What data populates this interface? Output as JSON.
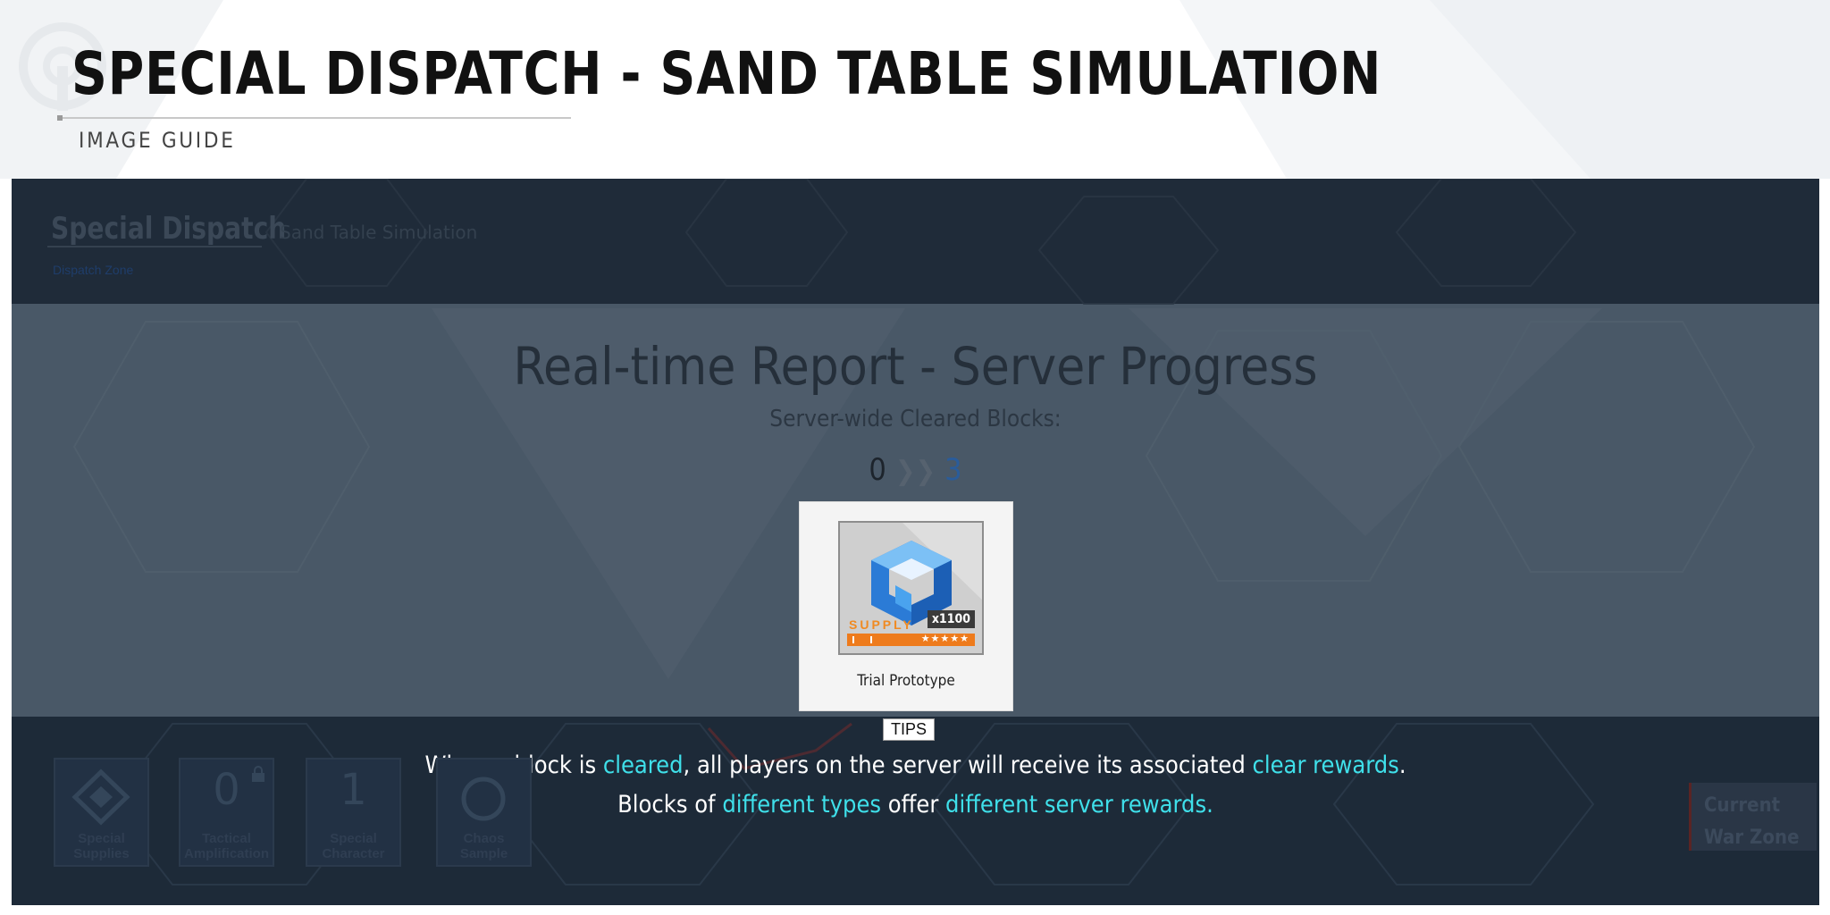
{
  "header": {
    "title": "SPECIAL DISPATCH - SAND TABLE SIMULATION",
    "subtitle": "IMAGE GUIDE"
  },
  "background_ui": {
    "title": "Special Dispatch",
    "subtitle": "Sand Table Simulation",
    "breadcrumb": "Dispatch Zone",
    "dock": [
      {
        "label": "Special Supplies",
        "value": ""
      },
      {
        "label": "Tactical Amplification",
        "value": "0"
      },
      {
        "label": "Special Character",
        "value": "1"
      },
      {
        "label": "Chaos Sample",
        "value": ""
      }
    ],
    "war_zone": "Current War Zone"
  },
  "report": {
    "title": "Real-time Report - Server Progress",
    "subtitle": "Server-wide Cleared Blocks:",
    "current": "0",
    "target": "3"
  },
  "reward": {
    "name": "Trial Prototype",
    "quantity": "x1100",
    "tag": "SUPPLY",
    "stars": "★★★★★"
  },
  "tips": {
    "label": "TIPS",
    "line1": {
      "a": "When a block is ",
      "b": "cleared",
      "c": ", all players on the server will receive its associated ",
      "d": "clear rewards",
      "e": "."
    },
    "line2": {
      "a": "Blocks of ",
      "b": "different types",
      "c": " offer ",
      "d": "different server rewards."
    }
  },
  "colors": {
    "highlight": "#3fe0ea",
    "overlay": "#495867",
    "dark": "#1d2a38",
    "rarity": "#ee7b1c"
  }
}
